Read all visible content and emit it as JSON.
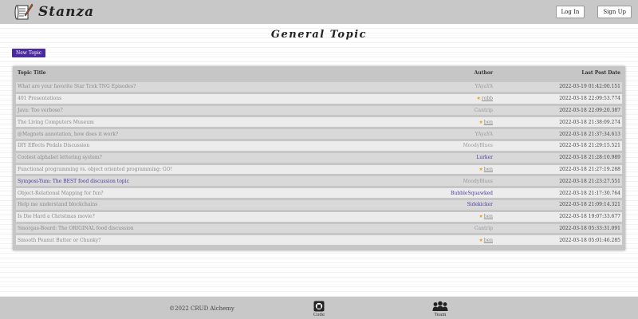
{
  "app": {
    "name": "Stanza"
  },
  "header": {
    "login_label": "Log In",
    "signup_label": "Sign Up"
  },
  "page": {
    "title": "General Topic",
    "new_topic_label": "New Topic"
  },
  "table": {
    "columns": {
      "title": "Topic Title",
      "author": "Author",
      "date": "Last Post Date"
    },
    "rows": [
      {
        "title": "What are your favorite Star Trek TNG Episodes?",
        "author": "YAyaYA",
        "date": "2022-03-19 01:42:00.151"
      },
      {
        "title": "401 Presentations",
        "author": "robb",
        "date": "2022-03-18 22:09:53.774"
      },
      {
        "title": "Java: Too verbose?",
        "author": "Cantrip",
        "date": "2022-03-18 22:09:20.387"
      },
      {
        "title": "The Living Computers Museum",
        "author": "ben",
        "date": "2022-03-18 21:38:09.274"
      },
      {
        "title": "@Magnets annotation, how does it work?",
        "author": "YAyaYA",
        "date": "2022-03-18 21:37:34.613"
      },
      {
        "title": "DIY Effects Pedals Discussion",
        "author": "MoodyBlues",
        "date": "2022-03-18 21:29:15.521"
      },
      {
        "title": "Coolest alphabet lettering system?",
        "author": "Lurker",
        "date": "2022-03-18 21:28:10.989"
      },
      {
        "title": "Functional programming vs. object oriented programming: GO!",
        "author": "ben",
        "date": "2022-03-18 21:27:19.288"
      },
      {
        "title": "Symposi-Yum: The BEST food discussion topic",
        "author": "MoodyBlues",
        "date": "2022-03-18 21:23:27.551"
      },
      {
        "title": "Object-Relational Mapping for fun?",
        "author": "BubbleSquawked",
        "date": "2022-03-18 21:17:30.764"
      },
      {
        "title": "Help me understand blockchains",
        "author": "Sidekicker",
        "date": "2022-03-18 21:09:14.321"
      },
      {
        "title": "Is Die Hard a Christmas movie?",
        "author": "ben",
        "date": "2022-03-18 19:07:33.677"
      },
      {
        "title": "Smorgas-Board: The ORIGINAL food discussion",
        "author": "Cantrip",
        "date": "2022-03-18 05:33:31.091"
      },
      {
        "title": "Smooth Peanut Butter or Chunky?",
        "author": "ben",
        "date": "2022-03-18 05:01:46.285"
      }
    ]
  },
  "footer": {
    "copyright": "©2022 CRUD Alchemy",
    "code_label": "Code",
    "team_label": "Team"
  },
  "colors": {
    "accent": "#4b2a9e",
    "link": "#4b3aa0",
    "star": "#e8a419",
    "header_bg": "#c8c8c8"
  }
}
